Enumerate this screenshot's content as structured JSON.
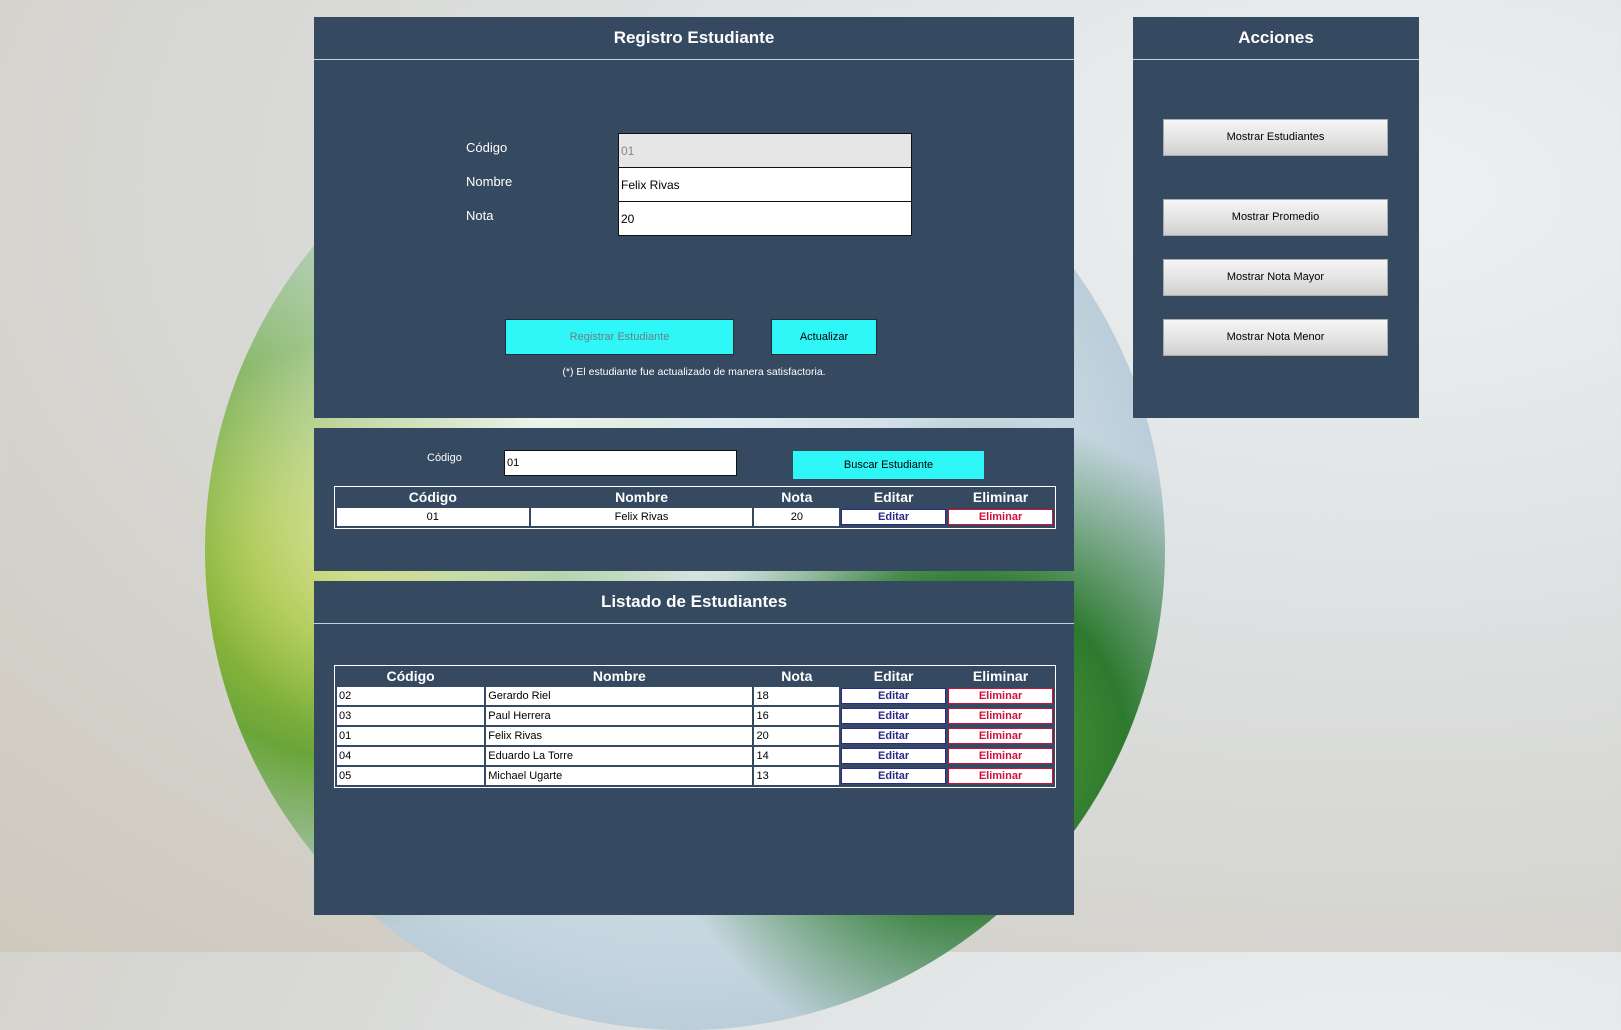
{
  "registro": {
    "title": "Registro Estudiante",
    "codigo_label": "Código",
    "nombre_label": "Nombre",
    "nota_label": "Nota",
    "codigo_value": "01",
    "nombre_value": "Felix Rivas",
    "nota_value": "20",
    "registrar_label": "Registrar Estudiante",
    "actualizar_label": "Actualizar",
    "message": "(*) El estudiante fue actualizado de manera satisfactoria."
  },
  "acciones": {
    "title": "Acciones",
    "buttons": [
      "Mostrar Estudiantes",
      "Mostrar Promedio",
      "Mostrar Nota Mayor",
      "Mostrar Nota Menor"
    ]
  },
  "buscar": {
    "codigo_label": "Código",
    "codigo_value": "01",
    "button_label": "Buscar Estudiante",
    "headers": [
      "Código",
      "Nombre",
      "Nota",
      "Editar",
      "Eliminar"
    ],
    "rows": [
      {
        "codigo": "01",
        "nombre": "Felix Rivas",
        "nota": "20",
        "editar": "Editar",
        "eliminar": "Eliminar"
      }
    ]
  },
  "listado": {
    "title": "Listado de Estudiantes",
    "headers": [
      "Código",
      "Nombre",
      "Nota",
      "Editar",
      "Eliminar"
    ],
    "rows": [
      {
        "codigo": "02",
        "nombre": "Gerardo Riel",
        "nota": "18",
        "editar": "Editar",
        "eliminar": "Eliminar"
      },
      {
        "codigo": "03",
        "nombre": "Paul Herrera",
        "nota": "16",
        "editar": "Editar",
        "eliminar": "Eliminar"
      },
      {
        "codigo": "01",
        "nombre": "Felix Rivas",
        "nota": "20",
        "editar": "Editar",
        "eliminar": "Eliminar"
      },
      {
        "codigo": "04",
        "nombre": "Eduardo La Torre",
        "nota": "14",
        "editar": "Editar",
        "eliminar": "Eliminar"
      },
      {
        "codigo": "05",
        "nombre": "Michael Ugarte",
        "nota": "13",
        "editar": "Editar",
        "eliminar": "Eliminar"
      }
    ]
  },
  "colors": {
    "panel": "#354960",
    "accent_cyan": "#2ff7f7",
    "edit": "#2a2a8a",
    "delete": "#d0103a"
  }
}
